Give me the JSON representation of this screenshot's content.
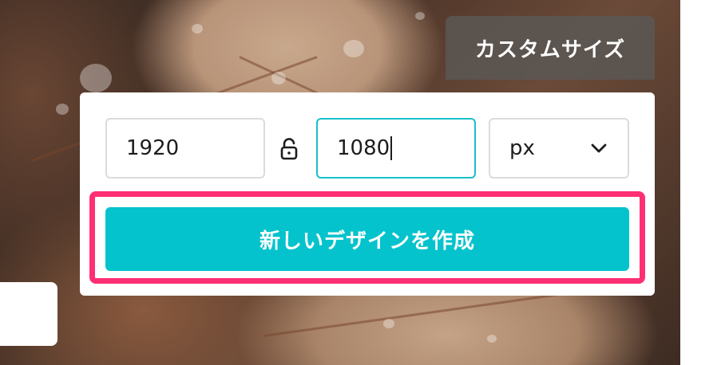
{
  "header": {
    "custom_size_label": "カスタムサイズ"
  },
  "dimensions": {
    "width_value": "1920",
    "height_value": "1080",
    "unit": "px"
  },
  "icons": {
    "lock": "lock-open-icon",
    "dropdown": "chevron-down-icon"
  },
  "actions": {
    "create_label": "新しいデザインを作成"
  },
  "colors": {
    "accent": "#05c3cc",
    "highlight": "#ff2f73",
    "tab_bg": "#5a5856"
  }
}
